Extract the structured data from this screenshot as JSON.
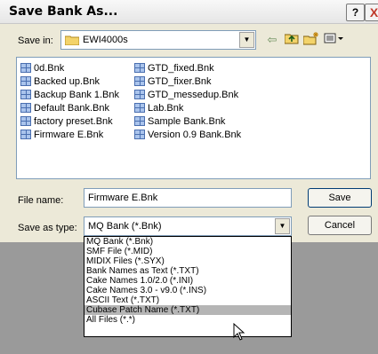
{
  "dialog": {
    "title": "Save Bank As...",
    "help": "?",
    "close": "X"
  },
  "save_in": {
    "label": "Save in:",
    "value": "EWI4000s"
  },
  "toolbar": {
    "back_icon": "back-arrow-icon",
    "up_icon": "up-folder-icon",
    "new_folder_icon": "new-folder-icon",
    "views_icon": "views-menu-icon"
  },
  "files_left": [
    "0d.Bnk",
    "Backed up.Bnk",
    "Backup Bank 1.Bnk",
    "Default Bank.Bnk",
    "factory preset.Bnk",
    "Firmware E.Bnk"
  ],
  "files_right": [
    "GTD_fixed.Bnk",
    "GTD_fixer.Bnk",
    "GTD_messedup.Bnk",
    "Lab.Bnk",
    "Sample Bank.Bnk",
    "Version 0.9 Bank.Bnk"
  ],
  "file_name": {
    "label": "File name:",
    "value": "Firmware E.Bnk"
  },
  "save_as_type": {
    "label": "Save as type:",
    "value": "MQ Bank (*.Bnk)"
  },
  "buttons": {
    "save": "Save",
    "cancel": "Cancel"
  },
  "type_options": [
    "MQ Bank (*.Bnk)",
    "SMF File (*.MID)",
    "MIDIX Files (*.SYX)",
    "Bank Names as Text (*.TXT)",
    "Cake Names 1.0/2.0 (*.INI)",
    "Cake Names 3.0 - v9.0 (*.INS)",
    "ASCII Text (*.TXT)",
    "Cubase Patch Name (*.TXT)",
    "All Files (*.*)"
  ],
  "highlighted_option": "Cubase Patch Name (*.TXT)"
}
